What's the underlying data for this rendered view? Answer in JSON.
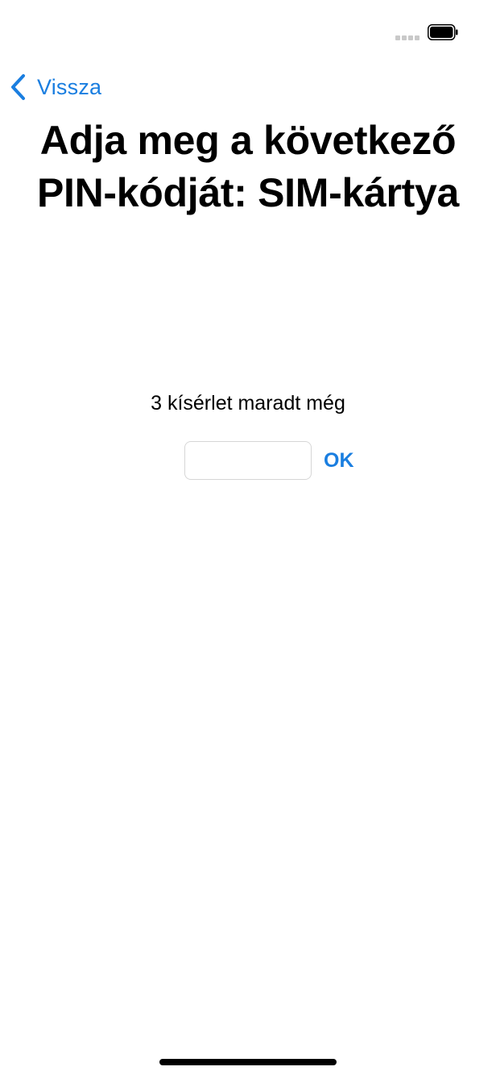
{
  "status_bar": {
    "signal_icon": "cellular-signal-dots-icon",
    "battery_icon": "battery-full-icon"
  },
  "nav": {
    "back_label": "Vissza",
    "back_icon": "chevron-left-icon",
    "accent_color": "#1a7ee0"
  },
  "title": "Adja meg a következő PIN-kódját: SIM-kártya",
  "attempts_text": "3 kísérlet maradt még",
  "pin_field": {
    "value": "",
    "placeholder": ""
  },
  "ok_label": "OK"
}
